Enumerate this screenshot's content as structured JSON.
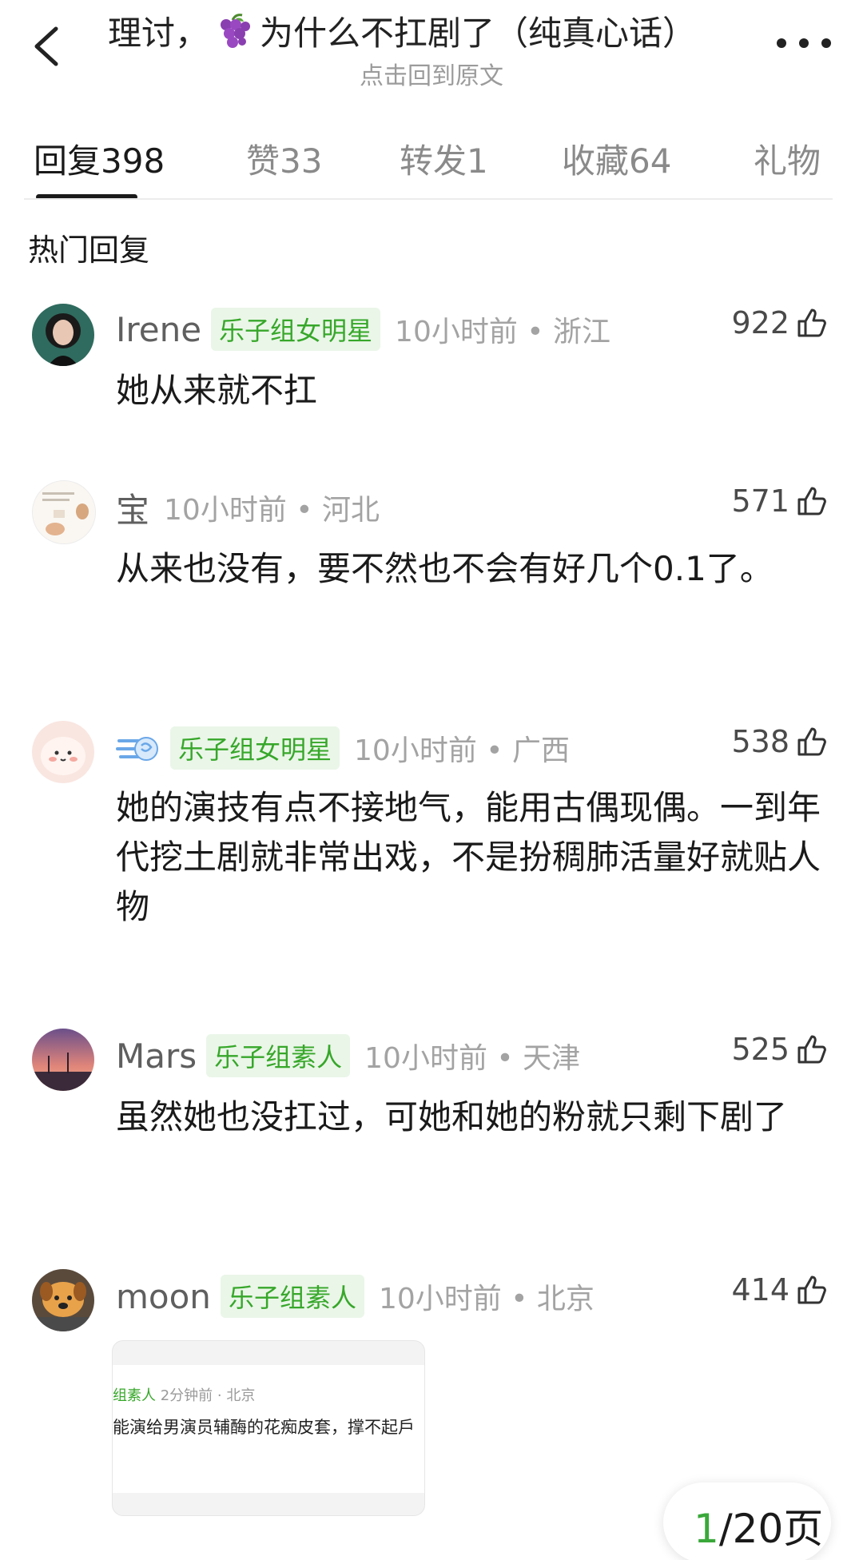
{
  "header": {
    "title_prefix": "理讨，",
    "title_suffix": "为什么不扛剧了（纯真心话）",
    "title_emoji": "grape-icon",
    "subtitle": "点击回到原文"
  },
  "tabs": [
    {
      "label": "回复",
      "count": "398"
    },
    {
      "label": "赞",
      "count": "33"
    },
    {
      "label": "转发",
      "count": "1"
    },
    {
      "label": "收藏",
      "count": "64"
    },
    {
      "label": "礼物",
      "count": ""
    }
  ],
  "section_title": "热门回复",
  "comments": [
    {
      "username": "Irene",
      "badge": "乐子组女明星",
      "time": "10小时前 • 浙江",
      "likes": "922",
      "content": "她从来就不扛"
    },
    {
      "username": "宝",
      "badge": "",
      "time": "10小时前 • 河北",
      "likes": "571",
      "content": "从来也没有，要不然也不会有好几个0.1了。"
    },
    {
      "username": "",
      "badge": "乐子组女明星",
      "time": "10小时前 • 广西",
      "likes": "538",
      "content": "她的演技有点不接地气，能用古偶现偶。一到年代挖土剧就非常出戏，不是扮稠肺活量好就贴人物"
    },
    {
      "username": "Mars",
      "badge": "乐子组素人",
      "time": "10小时前 • 天津",
      "likes": "525",
      "content": "虽然她也没扛过，可她和她的粉就只剩下剧了"
    },
    {
      "username": "moon",
      "badge": "乐子组素人",
      "time": "10小时前 • 北京",
      "likes": "414",
      "content": ""
    }
  ],
  "attachment": {
    "badge": "组素人",
    "meta": "2分钟前 · 北京",
    "text": "能演给男演员辅酶的花痴皮套，撑不起戶"
  },
  "pager": {
    "current": "1",
    "rest": "/20页"
  },
  "colors": {
    "accent_green": "#37a72a",
    "badge_bg": "#eaf6e8"
  }
}
